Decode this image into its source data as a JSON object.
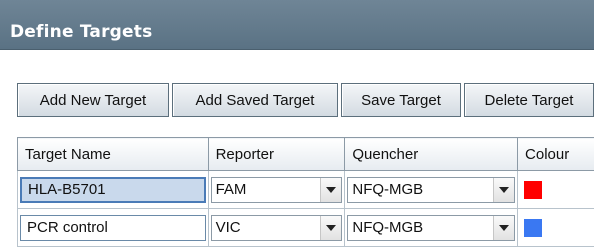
{
  "header": {
    "title": "Define Targets"
  },
  "toolbar": {
    "buttons": [
      {
        "label": "Add New Target"
      },
      {
        "label": "Add Saved Target"
      },
      {
        "label": "Save Target"
      },
      {
        "label": "Delete Target"
      }
    ]
  },
  "table": {
    "columns": [
      "Target Name",
      "Reporter",
      "Quencher",
      "Colour"
    ],
    "rows": [
      {
        "target_name": "HLA-B5701",
        "reporter": "FAM",
        "quencher": "NFQ-MGB",
        "colour": "#ff0000",
        "selected": true
      },
      {
        "target_name": "PCR control",
        "reporter": "VIC",
        "quencher": "NFQ-MGB",
        "colour": "#3a78f2",
        "selected": false
      }
    ]
  },
  "icons": {
    "dropdown": "chevron-down-icon"
  }
}
